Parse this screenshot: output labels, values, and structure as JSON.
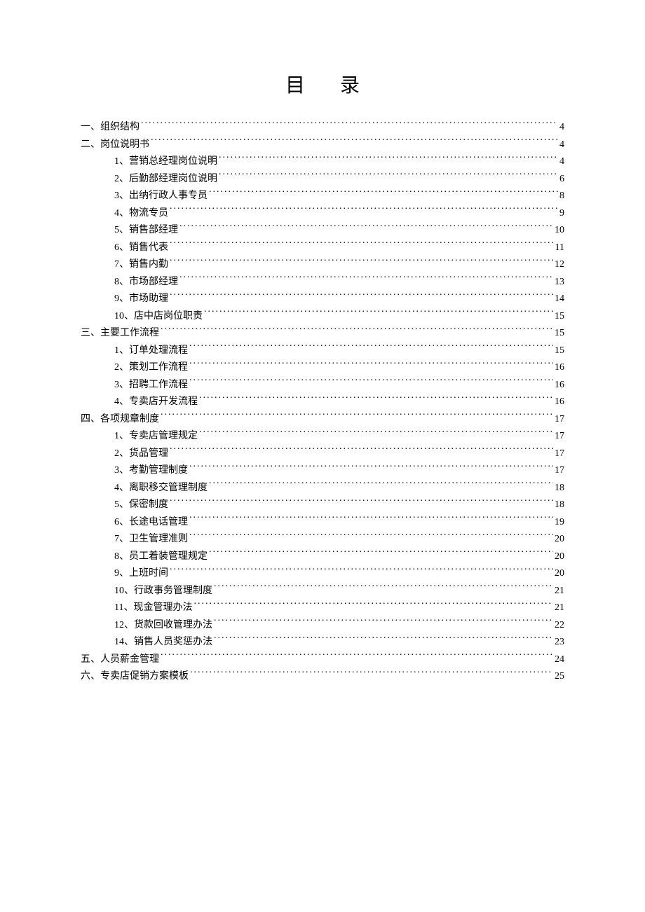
{
  "title": "目录",
  "entries": [
    {
      "level": 1,
      "label": "一、组织结构",
      "page": "4"
    },
    {
      "level": 1,
      "label": "二、岗位说明书",
      "page": "4"
    },
    {
      "level": 2,
      "label": "1、营销总经理岗位说明",
      "page": "4"
    },
    {
      "level": 2,
      "label": "2、后勤部经理岗位说明",
      "page": "6"
    },
    {
      "level": 2,
      "label": "3、出纳行政人事专员",
      "page": "8"
    },
    {
      "level": 2,
      "label": "4、物流专员",
      "page": "9"
    },
    {
      "level": 2,
      "label": "5、销售部经理",
      "page": "10"
    },
    {
      "level": 2,
      "label": "6、销售代表",
      "page": "11"
    },
    {
      "level": 2,
      "label": "7、销售内勤",
      "page": "12"
    },
    {
      "level": 2,
      "label": "8、市场部经理",
      "page": "13"
    },
    {
      "level": 2,
      "label": "9、市场助理",
      "page": "14"
    },
    {
      "level": 2,
      "label": "10、店中店岗位职责",
      "page": "15"
    },
    {
      "level": 1,
      "label": "三、主要工作流程",
      "page": "15"
    },
    {
      "level": 2,
      "label": "1、订单处理流程",
      "page": "15"
    },
    {
      "level": 2,
      "label": "2、策划工作流程",
      "page": "16"
    },
    {
      "level": 2,
      "label": "3、招聘工作流程",
      "page": "16"
    },
    {
      "level": 2,
      "label": "4、专卖店开发流程",
      "page": "16"
    },
    {
      "level": 1,
      "label": "四、各项规章制度",
      "page": "17"
    },
    {
      "level": 2,
      "label": "1、专卖店管理规定",
      "page": "17"
    },
    {
      "level": 2,
      "label": "2、货品管理",
      "page": "17"
    },
    {
      "level": 2,
      "label": "3、考勤管理制度",
      "page": "17"
    },
    {
      "level": 2,
      "label": "4、离职移交管理制度",
      "page": "18"
    },
    {
      "level": 2,
      "label": "5、保密制度",
      "page": "18"
    },
    {
      "level": 2,
      "label": "6、长途电话管理",
      "page": "19"
    },
    {
      "level": 2,
      "label": "7、卫生管理准则",
      "page": "20"
    },
    {
      "level": 2,
      "label": "8、员工着装管理规定",
      "page": "20"
    },
    {
      "level": 2,
      "label": "9、上班时间",
      "page": "20"
    },
    {
      "level": 2,
      "label": "10、行政事务管理制度",
      "page": "21"
    },
    {
      "level": 2,
      "label": "11、现金管理办法",
      "page": "21"
    },
    {
      "level": 2,
      "label": "12、货款回收管理办法",
      "page": "22"
    },
    {
      "level": 2,
      "label": "14、销售人员奖惩办法",
      "page": "23"
    },
    {
      "level": 1,
      "label": "五、人员薪金管理",
      "page": "24"
    },
    {
      "level": 1,
      "label": "六、专卖店促销方案模板",
      "page": "25"
    }
  ]
}
